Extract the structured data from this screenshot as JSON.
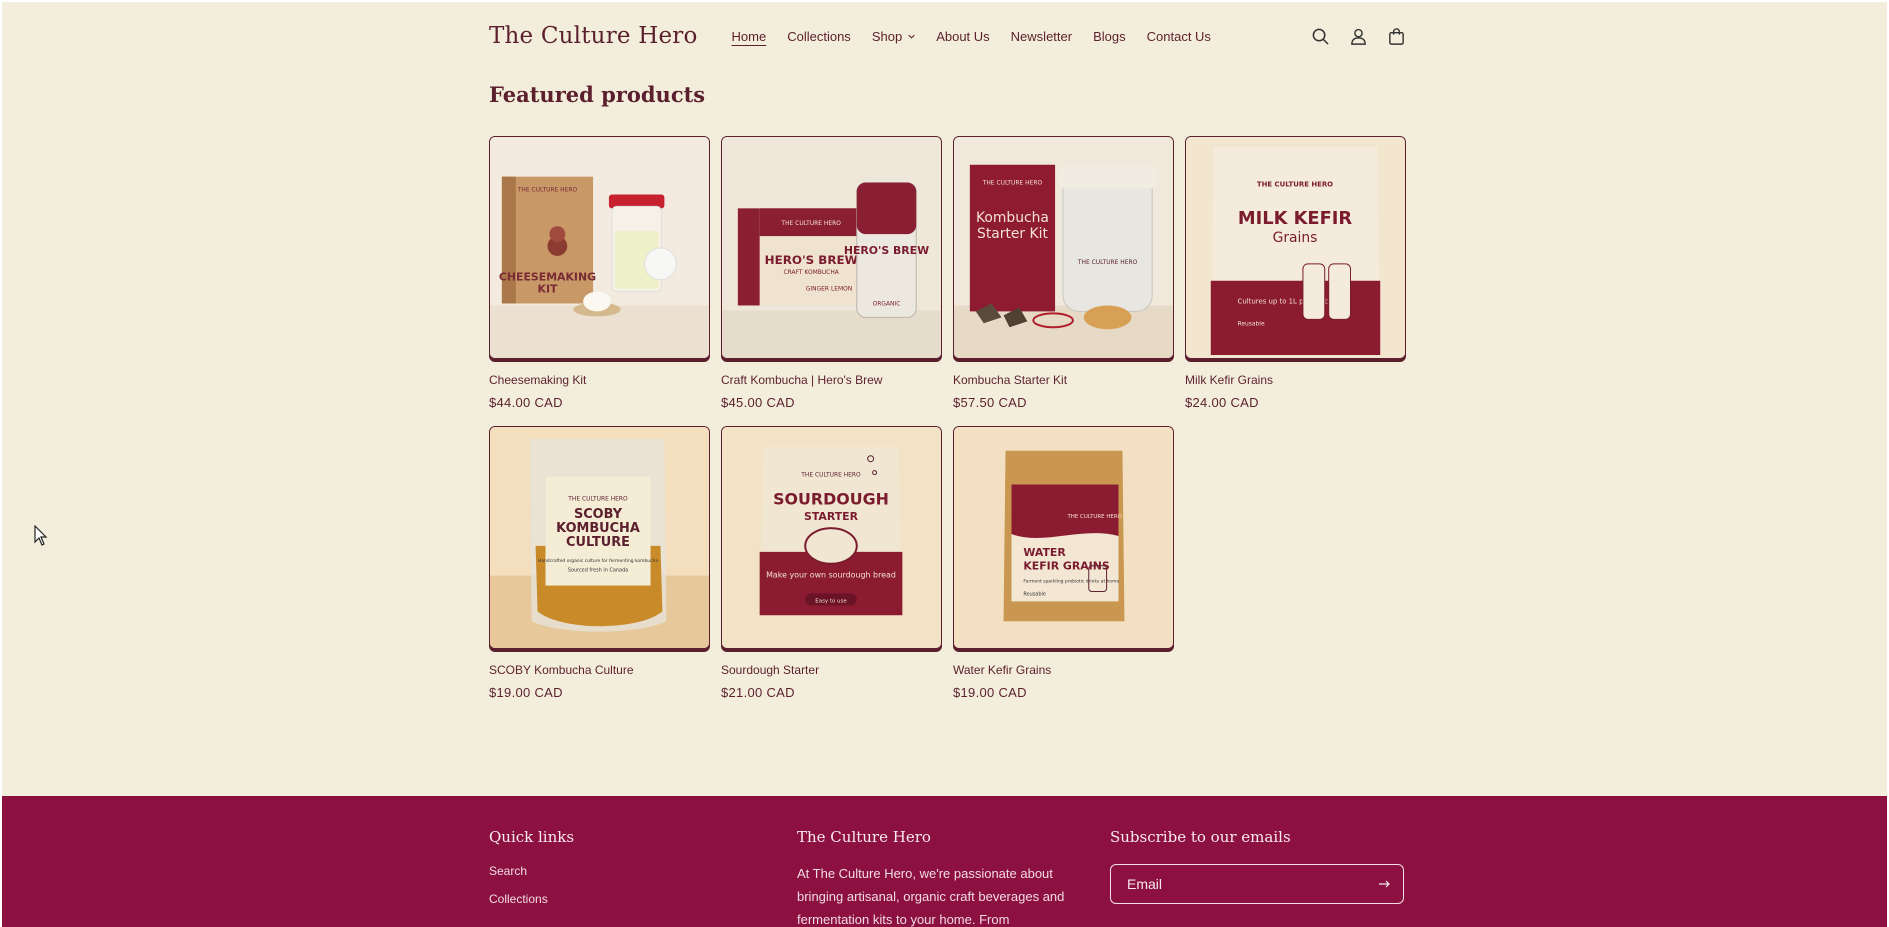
{
  "store": {
    "name": "The Culture Hero"
  },
  "nav": {
    "items": [
      {
        "label": "Home",
        "active": true
      },
      {
        "label": "Collections"
      },
      {
        "label": "Shop",
        "dropdown": true
      },
      {
        "label": "About Us"
      },
      {
        "label": "Newsletter"
      },
      {
        "label": "Blogs"
      },
      {
        "label": "Contact Us"
      }
    ],
    "icons": [
      "search-icon",
      "account-icon",
      "cart-icon"
    ]
  },
  "featured": {
    "title": "Featured products",
    "products": [
      {
        "title": "Cheesemaking Kit",
        "price": "$44.00 CAD",
        "image_text": [
          "THE CULTURE HERO",
          "CHEESEMAKING",
          "KIT"
        ]
      },
      {
        "title": "Craft Kombucha | Hero's Brew",
        "price": "$45.00 CAD",
        "image_text": [
          "THE CULTURE HERO",
          "HERO'S BREW",
          "CRAFT KOMBUCHA",
          "GINGER LEMON",
          "ORGANIC"
        ]
      },
      {
        "title": "Kombucha Starter Kit",
        "price": "$57.50 CAD",
        "image_text": [
          "THE CULTURE HERO",
          "Kombucha",
          "Starter Kit"
        ]
      },
      {
        "title": "Milk Kefir Grains",
        "price": "$24.00 CAD",
        "image_text": [
          "THE CULTURE HERO",
          "MILK KEFIR",
          "Grains",
          "Cultures up to 1L per batch",
          "Reusable"
        ]
      },
      {
        "title": "SCOBY Kombucha Culture",
        "price": "$19.00 CAD",
        "image_text": [
          "THE CULTURE HERO",
          "SCOBY",
          "KOMBUCHA",
          "CULTURE",
          "Handcrafted organic culture for fermenting kombucha",
          "Sourced fresh in Canada"
        ]
      },
      {
        "title": "Sourdough Starter",
        "price": "$21.00 CAD",
        "image_text": [
          "THE CULTURE HERO",
          "SOURDOUGH",
          "STARTER",
          "Make your own sourdough bread",
          "Easy to use"
        ]
      },
      {
        "title": "Water Kefir Grains",
        "price": "$19.00 CAD",
        "image_text": [
          "THE CULTURE HERO",
          "WATER",
          "KEFIR GRAINS",
          "Ferment sparkling probiotic drinks at home",
          "Reusable"
        ]
      }
    ]
  },
  "footer": {
    "quick_links": {
      "title": "Quick links",
      "links": [
        "Search",
        "Collections"
      ]
    },
    "about": {
      "title": "The Culture Hero",
      "text": "At The Culture Hero, we're passionate about bringing artisanal, organic craft beverages and fermentation kits to your home. From"
    },
    "subscribe": {
      "title": "Subscribe to our emails",
      "placeholder": "Email"
    }
  },
  "colors": {
    "background": "#f3eedb",
    "primary": "#5b1f2e",
    "footer": "#8c1140"
  }
}
